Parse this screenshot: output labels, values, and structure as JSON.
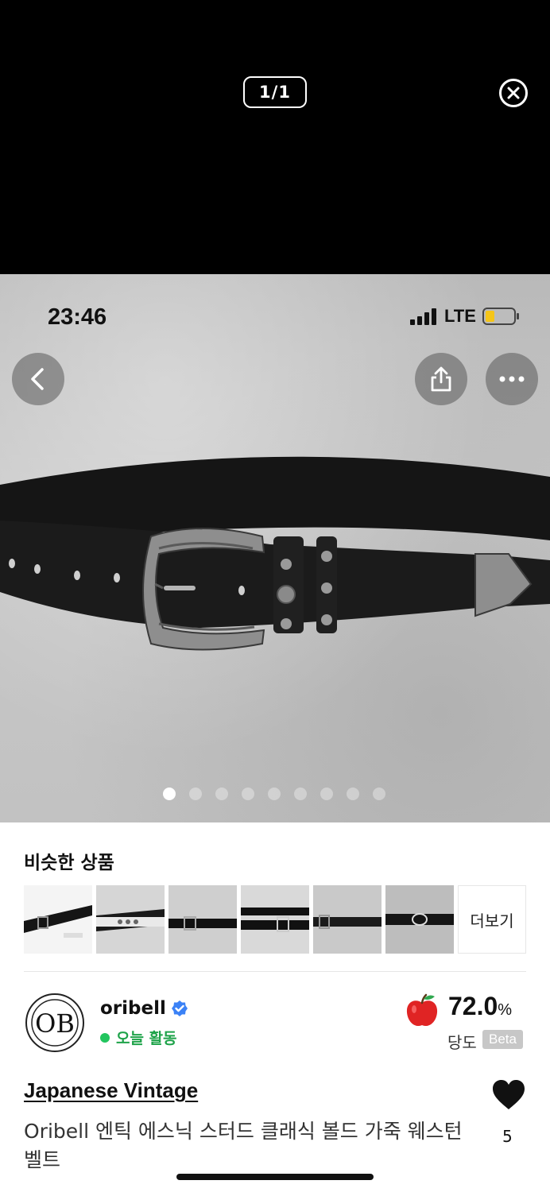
{
  "viewer": {
    "counter": "1/1"
  },
  "photo": {
    "status_time": "23:46",
    "network": "LTE",
    "slide_count": 9,
    "active_slide": 1
  },
  "similar": {
    "title": "비슷한 상품",
    "more_label": "더보기",
    "thumbnail_count": 6
  },
  "seller": {
    "avatar_text": "OB",
    "name": "oribell",
    "activity": "오늘 활동",
    "sweetness_value": "72.0",
    "sweetness_unit": "%",
    "sweetness_label": "당도",
    "beta_label": "Beta"
  },
  "product": {
    "brand": "Japanese Vintage",
    "name": "Oribell 엔틱 에스닉 스터드 클래식 볼드 가죽 웨스턴 벨트",
    "like_count": "5"
  },
  "colors": {
    "active_green": "#22c55e",
    "verified_blue": "#3b82f6",
    "apple_red": "#e02424"
  }
}
